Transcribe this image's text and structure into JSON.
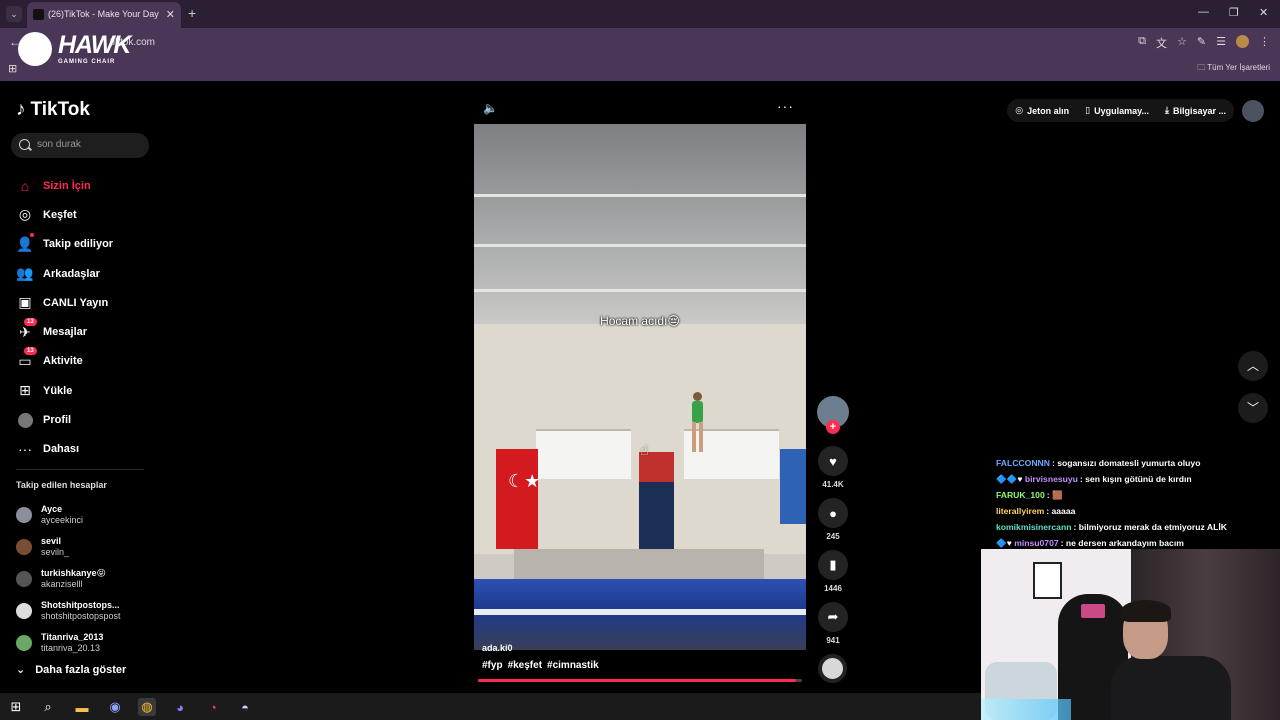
{
  "browser": {
    "tab_title": "(26)TikTok - Make Your Day",
    "tab_close": "✕",
    "new_tab": "+",
    "url": "tiktok.com",
    "bookmarks_all": "Tüm Yer İşaretleri",
    "window_controls": [
      "—",
      "❐",
      "✕"
    ]
  },
  "overlay_logo": {
    "title": "HAWK",
    "subtitle": "GAMING CHAIR"
  },
  "sidebar": {
    "logo_text": "TikTok",
    "search_placeholder": "son durak",
    "nav": [
      {
        "label": "Sizin İçin",
        "icon": "home-icon",
        "active": true
      },
      {
        "label": "Keşfet",
        "icon": "compass-icon"
      },
      {
        "label": "Takip ediliyor",
        "icon": "following-icon"
      },
      {
        "label": "Arkadaşlar",
        "icon": "friends-icon"
      },
      {
        "label": "CANLI Yayın",
        "icon": "live-icon"
      },
      {
        "label": "Mesajlar",
        "icon": "messages-icon",
        "badge": "13"
      },
      {
        "label": "Aktivite",
        "icon": "activity-icon",
        "badge": "13"
      },
      {
        "label": "Yükle",
        "icon": "upload-icon"
      },
      {
        "label": "Profil",
        "icon": "profile-icon"
      },
      {
        "label": "Dahası",
        "icon": "more-icon"
      }
    ],
    "following_title": "Takip edilen hesaplar",
    "following": [
      {
        "name": "Ayce",
        "handle": "ayceekinci",
        "color": "#8a8f99"
      },
      {
        "name": "sevil",
        "handle": "seviln_",
        "color": "#7a4e35"
      },
      {
        "name": "turkishkanye😝",
        "handle": "akanziselll",
        "color": "#555555"
      },
      {
        "name": "Shotshitpostops...",
        "handle": "shotshitpostopspost",
        "color": "#dddddd"
      },
      {
        "name": "Titanriva_2013",
        "handle": "titanriva_20.13",
        "color": "#6aa86a"
      }
    ],
    "show_more": "Daha fazla göster"
  },
  "video": {
    "caption": "Hocam acıdı😔",
    "author": "ada.ki0",
    "tags": [
      "#fyp",
      "#keşfet",
      "#cimnastik"
    ],
    "progress": 0.98
  },
  "actions": {
    "likes": "41.4K",
    "comments": "245",
    "saves": "1446",
    "shares": "941"
  },
  "topright": {
    "coins": "Jeton alın",
    "app": "Uygulamay...",
    "desktop": "Bilgisayar ..."
  },
  "chat": [
    {
      "user": "FALCCONNN",
      "color": "#6fa8ff",
      "msg": ": sogansızı domatesli yumurta oluyo",
      "prefix": ""
    },
    {
      "user": "birvisnesuyu",
      "color": "#c58cff",
      "msg": ": sen kışın götünü de kırdın",
      "prefix": "🔷🔷♥ "
    },
    {
      "user": "FARUK_100",
      "color": "#8cff6b",
      "msg": ": 🟫",
      "prefix": ""
    },
    {
      "user": "literallyirem",
      "color": "#ffd45a",
      "msg": ": aaaaa",
      "prefix": ""
    },
    {
      "user": "komikmisinercann",
      "color": "#5fe0c8",
      "msg": ": bilmiyoruz merak da etmiyoruz ALİK",
      "prefix": ""
    },
    {
      "user": "minsu0707",
      "color": "#c58cff",
      "msg": ": ne dersen arkandayım bacım",
      "prefix": "🔷♥ "
    }
  ],
  "colors": {
    "accent": "#fe2c55",
    "background": "#000000",
    "tab_bar": "#2b1f33",
    "chrome": "#4a3656"
  }
}
